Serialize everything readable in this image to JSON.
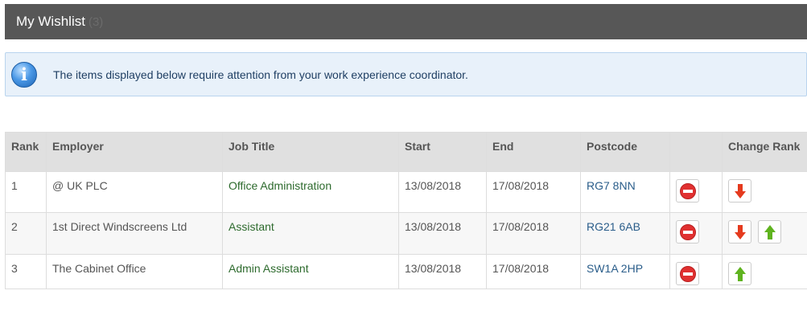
{
  "header": {
    "title": "My Wishlist",
    "count": "(3)"
  },
  "alert": {
    "icon": "info-icon",
    "message": "The items displayed below require attention from your work experience coordinator."
  },
  "table": {
    "headers": [
      "Rank",
      "Employer",
      "Job Title",
      "Start",
      "End",
      "Postcode",
      "",
      "Change Rank"
    ],
    "rows": [
      {
        "rank": "1",
        "employer": "@ UK PLC",
        "job_title": "Office Administration",
        "start": "13/08/2018",
        "end": "17/08/2018",
        "postcode": "RG7 8NN"
      },
      {
        "rank": "2",
        "employer": "1st Direct Windscreens Ltd",
        "job_title": "Assistant",
        "start": "13/08/2018",
        "end": "17/08/2018",
        "postcode": "RG21 6AB"
      },
      {
        "rank": "3",
        "employer": "The Cabinet Office",
        "job_title": "Admin Assistant",
        "start": "13/08/2018",
        "end": "17/08/2018",
        "postcode": "SW1A 2HP"
      }
    ]
  },
  "colors": {
    "header_bg": "#575757",
    "alert_bg": "#e8f1fa",
    "job_title": "#2d6a2d",
    "postcode": "#2a5d8a",
    "remove": "#e03030",
    "rank_down": "#e53a1e",
    "rank_up": "#5fb31f"
  }
}
